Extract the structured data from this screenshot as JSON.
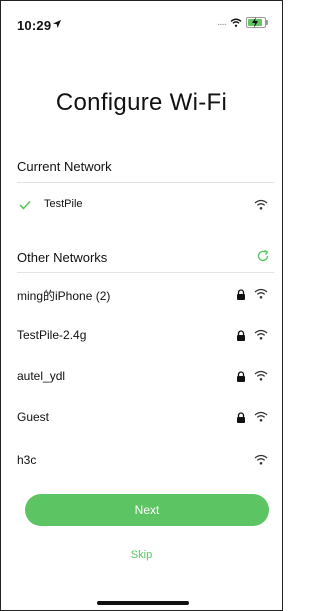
{
  "status_bar": {
    "time": "10:29",
    "signal_dots": "....."
  },
  "page": {
    "title": "Configure Wi-Fi"
  },
  "current_network": {
    "section_label": "Current Network",
    "name": "TestPile",
    "check_icon": "checkmark-icon",
    "wifi_icon": "wifi-icon"
  },
  "other_networks": {
    "section_label": "Other Networks",
    "refresh_icon": "refresh-icon",
    "items": [
      {
        "name": "ming的iPhone (2)",
        "locked": true
      },
      {
        "name": "TestPile-2.4g",
        "locked": true
      },
      {
        "name": "autel_ydl",
        "locked": true
      },
      {
        "name": "Guest",
        "locked": true
      },
      {
        "name": "h3c",
        "locked": false
      }
    ]
  },
  "actions": {
    "next_label": "Next",
    "skip_label": "Skip"
  },
  "colors": {
    "accent": "#5cc463",
    "divider": "#e3e3e3",
    "text": "#111111",
    "muted": "#9a9a9a"
  }
}
